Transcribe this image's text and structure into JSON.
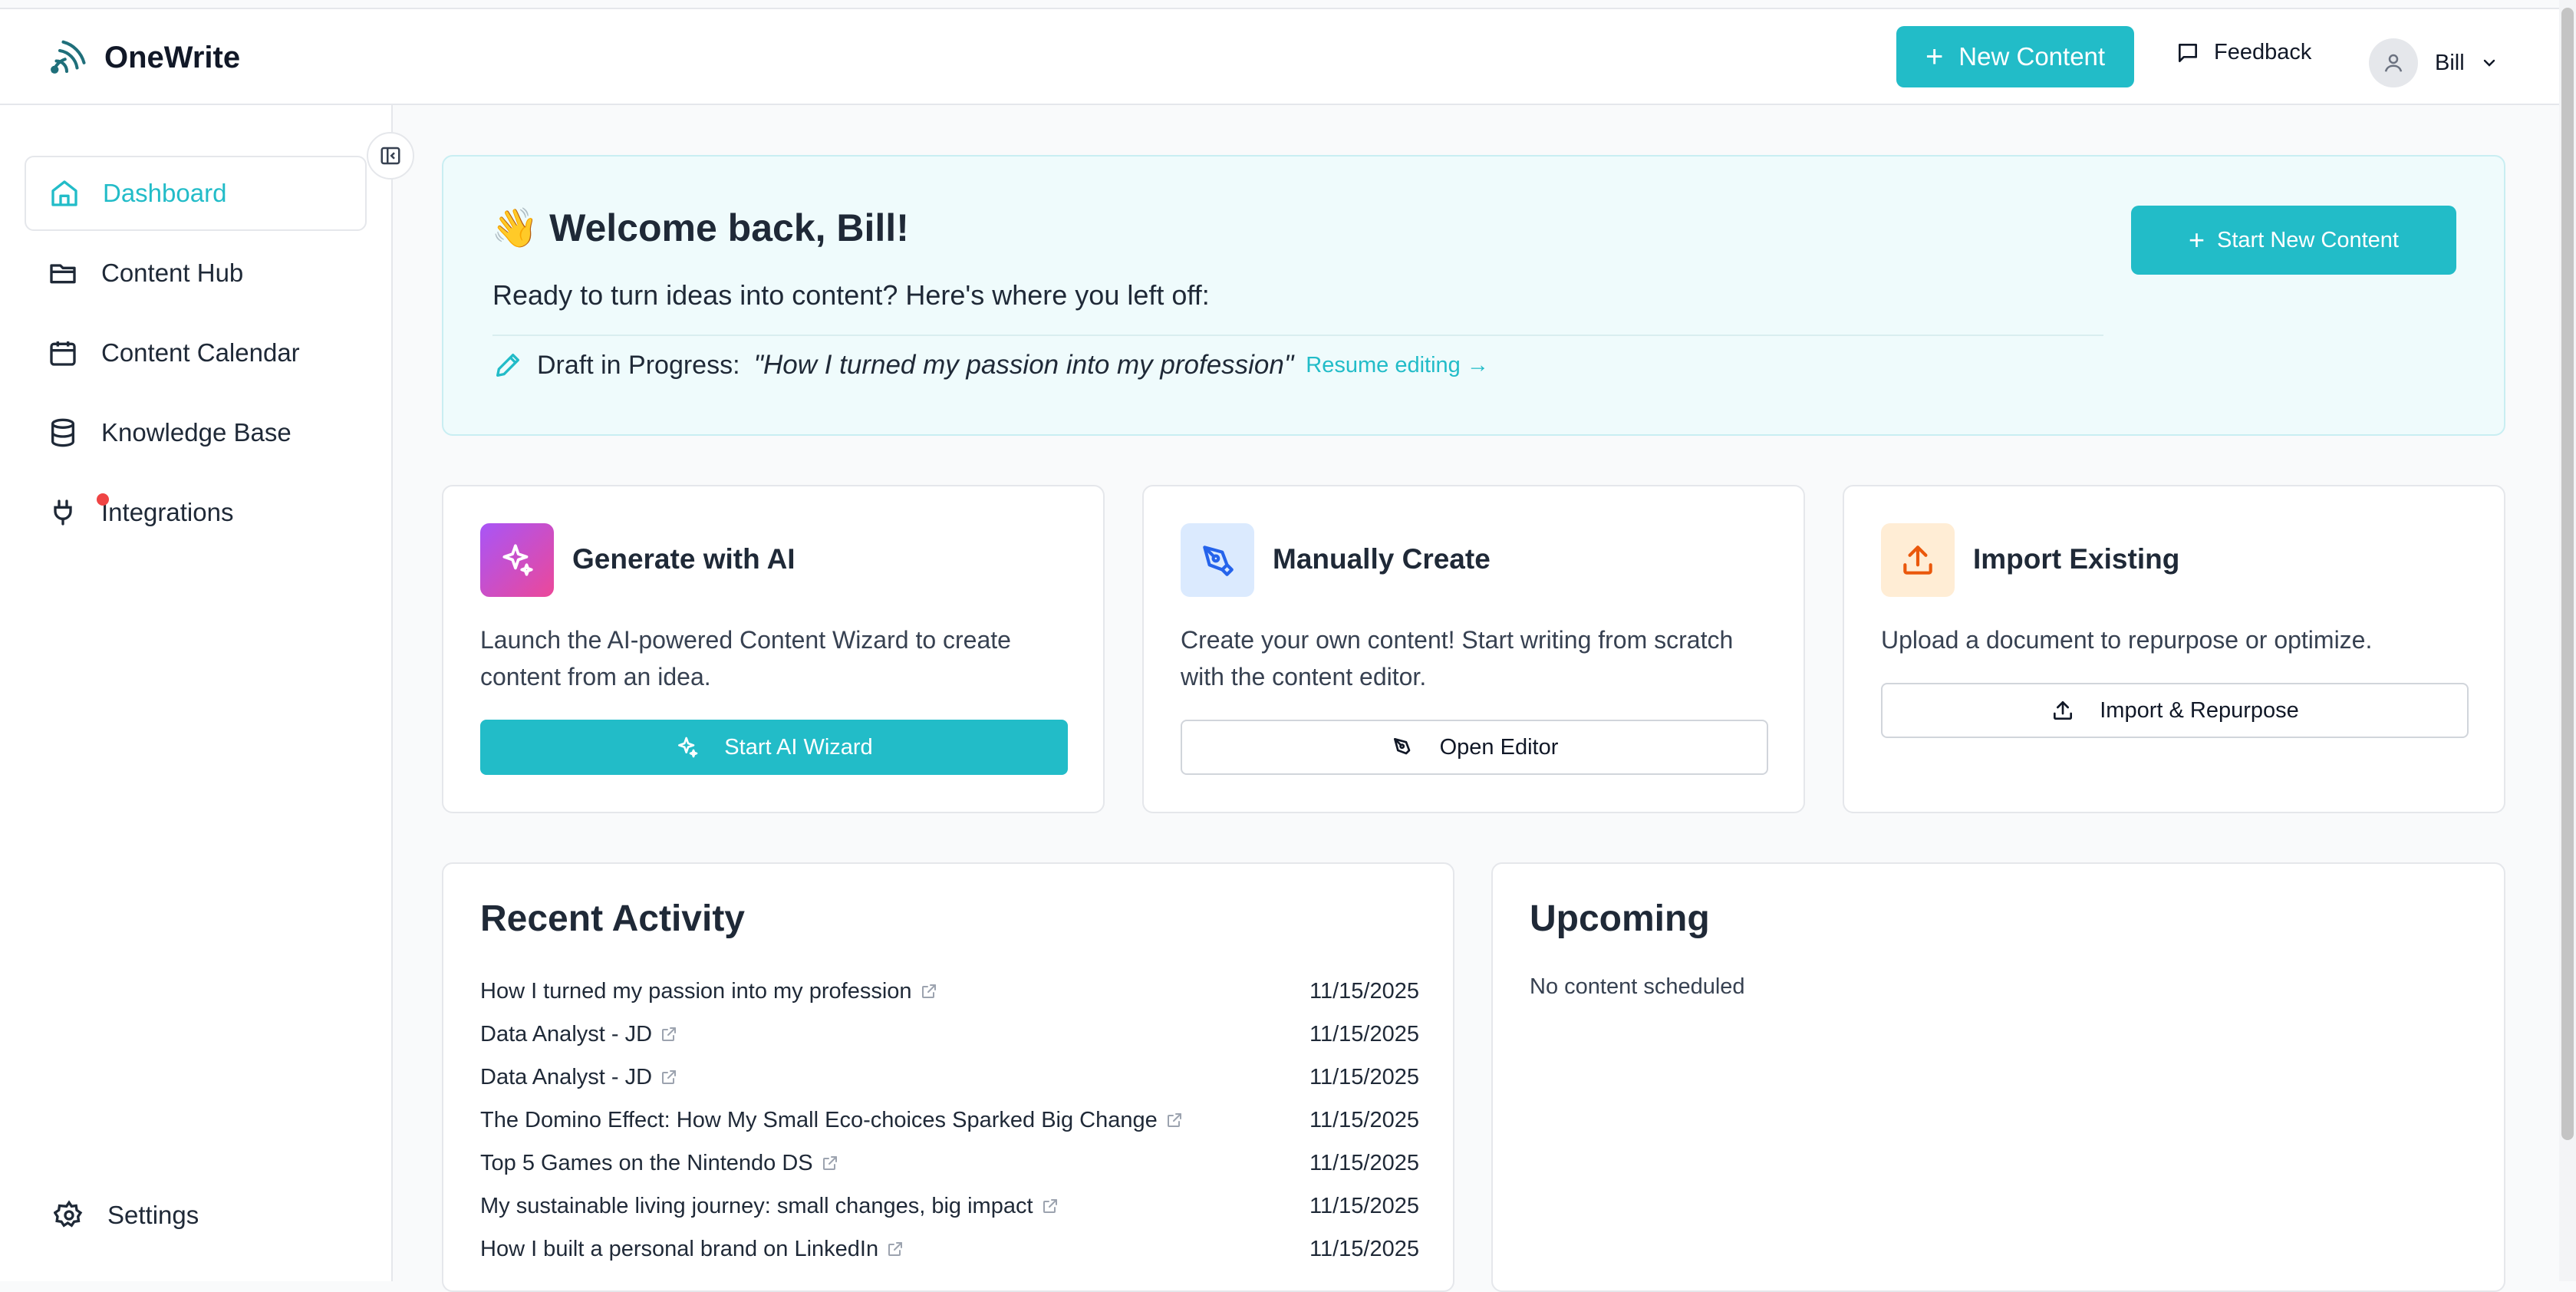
{
  "app": {
    "name": "OneWrite"
  },
  "header": {
    "new_content": "New Content",
    "feedback": "Feedback",
    "user_name": "Bill"
  },
  "sidebar": {
    "items": [
      {
        "label": "Dashboard",
        "icon": "home-icon",
        "active": true
      },
      {
        "label": "Content Hub",
        "icon": "folder-icon"
      },
      {
        "label": "Content Calendar",
        "icon": "calendar-icon"
      },
      {
        "label": "Knowledge Base",
        "icon": "database-icon"
      },
      {
        "label": "Integrations",
        "icon": "plug-icon"
      }
    ],
    "settings": "Settings"
  },
  "welcome": {
    "emoji": "👋",
    "title": "Welcome back, Bill!",
    "subtitle": "Ready to turn ideas into content? Here's where you left off:",
    "draft_label": "Draft in Progress:",
    "draft_title": "\"How I turned my passion into my profession\"",
    "resume": "Resume editing →",
    "start_new": "Start New Content"
  },
  "cards": [
    {
      "title": "Generate with AI",
      "desc": "Launch the AI-powered Content Wizard to create content from an idea.",
      "button": "Start AI Wizard"
    },
    {
      "title": "Manually Create",
      "desc": "Create your own content! Start writing from scratch with the content editor.",
      "button": "Open Editor"
    },
    {
      "title": "Import Existing",
      "desc": "Upload a document to repurpose or optimize.",
      "button": "Import & Repurpose"
    }
  ],
  "recent": {
    "title": "Recent Activity",
    "rows": [
      {
        "title": "How I turned my passion into my profession",
        "date": "11/15/2025"
      },
      {
        "title": "Data Analyst - JD",
        "date": "11/15/2025"
      },
      {
        "title": "Data Analyst - JD",
        "date": "11/15/2025"
      },
      {
        "title": "The Domino Effect: How My Small Eco-choices Sparked Big Change",
        "date": "11/15/2025"
      },
      {
        "title": "Top 5 Games on the Nintendo DS",
        "date": "11/15/2025"
      },
      {
        "title": "My sustainable living journey: small changes, big impact",
        "date": "11/15/2025"
      },
      {
        "title": "How I built a personal brand on LinkedIn",
        "date": "11/15/2025"
      }
    ]
  },
  "upcoming": {
    "title": "Upcoming",
    "empty": "No content scheduled"
  },
  "colors": {
    "accent": "#22bcc8",
    "notification": "#ef4444"
  }
}
